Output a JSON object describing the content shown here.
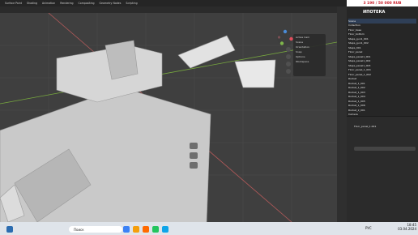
{
  "menubar": {
    "tabs": [
      "Surface Paint",
      "Shading",
      "Animation",
      "Rendering",
      "Compositing",
      "Geometry Nodes",
      "Scripting"
    ],
    "price": "3 190 / 50 000 RUB",
    "overlay_brand": "ИПОТЕКА"
  },
  "viewport": {
    "popup_items": [
      "Active Cam",
      "Scene",
      "Orientation",
      "Snap",
      "Options",
      "Workspace"
    ]
  },
  "outliner": {
    "rows": [
      "Scene",
      "Collection",
      "Floor_base",
      "Floor_bottom",
      "Steps_gun1_001",
      "Steps_gun1_002",
      "Steps_001",
      "Floor_panel",
      "Steps_panel1_001",
      "Steps_panel1_002",
      "Steps_panel1_003",
      "Floor_panel_1_001",
      "Floor_panel_1_002",
      "Rocket",
      "Rocket_1_001",
      "Rocket_1_002",
      "Rocket_1_003",
      "Rocket_1_004",
      "Rocket_1_005",
      "Rocket_1_006",
      "Rocket_2_001",
      "Camera"
    ],
    "selected_index": 0,
    "object_name": "Floor_panel_1.001"
  },
  "properties": {
    "label": "Floor_panel_1.001"
  },
  "taskbar": {
    "search_placeholder": "Поиск",
    "lang": "РУС",
    "time": "18:45",
    "date": "03.04.2024"
  }
}
